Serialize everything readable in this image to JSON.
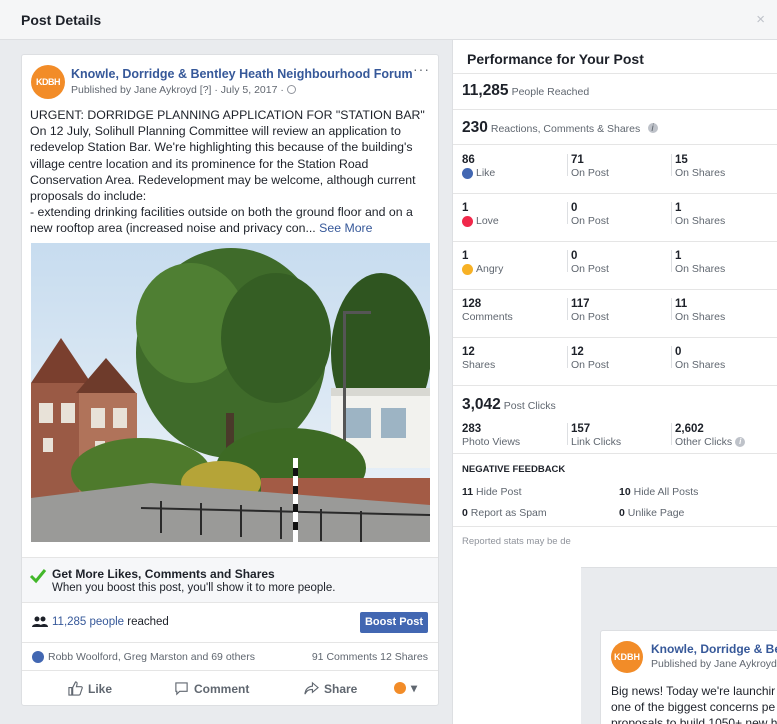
{
  "dialog": {
    "title": "Post Details",
    "close": "×"
  },
  "post": {
    "page_name": "Knowle, Dorridge & Bentley Heath Neighbourhood Forum",
    "avatar_text": "KDBH",
    "published": "Published by Jane Aykroyd [?] · July 5, 2017 · ",
    "more": "···",
    "text_lines": [
      "URGENT: DORRIDGE PLANNING APPLICATION FOR \"STATION BAR\"",
      "On 12 July, Solihull Planning Committee will review an application to redevelop Station Bar. We're highlighting this because of the building's village centre location and its prominence for the Station Road Conservation Area. Redevelopment may be welcome, although current proposals do include:",
      "- extending drinking facilities outside on both the ground floor and on a new rooftop area (increased noise and privacy con..."
    ],
    "see_more": "See More"
  },
  "boost_promo": {
    "title": "Get More Likes, Comments and Shares",
    "subtitle": "When you boost this post, you'll show it to more people."
  },
  "reach": {
    "link": "11,285 people",
    "suffix": " reached",
    "button": "Boost Post"
  },
  "reactions_bar": {
    "reactors": "Robb Woolford, Greg Marston and 69 others",
    "counts": "91 Comments  12 Shares"
  },
  "actions": {
    "like": "Like",
    "comment": "Comment",
    "share": "Share",
    "caret": "▾"
  },
  "performance": {
    "title": "Performance for Your Post",
    "people_reached": {
      "value": "11,285",
      "label": "People Reached"
    },
    "engagement": {
      "value": "230",
      "label": "Reactions, Comments & Shares"
    },
    "info_glyph": "i",
    "rows": [
      {
        "total": "86",
        "total_label": "Like",
        "icon": "like",
        "on_post": "71",
        "on_shares": "15"
      },
      {
        "total": "1",
        "total_label": "Love",
        "icon": "love",
        "on_post": "0",
        "on_shares": "1"
      },
      {
        "total": "1",
        "total_label": "Angry",
        "icon": "angry",
        "on_post": "0",
        "on_shares": "1"
      },
      {
        "total": "128",
        "total_label": "Comments",
        "icon": "",
        "on_post": "117",
        "on_shares": "11"
      },
      {
        "total": "12",
        "total_label": "Shares",
        "icon": "",
        "on_post": "12",
        "on_shares": "0"
      }
    ],
    "on_post_label": "On Post",
    "on_shares_label": "On Shares",
    "post_clicks": {
      "value": "3,042",
      "label": "Post Clicks"
    },
    "clicks": [
      {
        "value": "283",
        "label": "Photo Views"
      },
      {
        "value": "157",
        "label": "Link Clicks"
      },
      {
        "value": "2,602",
        "label": "Other Clicks"
      }
    ],
    "negative": {
      "title": "NEGATIVE FEEDBACK",
      "items": [
        {
          "value": "11",
          "label": "Hide Post"
        },
        {
          "value": "10",
          "label": "Hide All Posts"
        },
        {
          "value": "0",
          "label": "Report as Spam"
        },
        {
          "value": "0",
          "label": "Unlike Page"
        }
      ]
    },
    "footnote": "Reported stats may be de"
  },
  "overlay_post": {
    "page_name": "Knowle, Dorridge & Be",
    "avatar_text": "KDBH",
    "published": "Published by Jane Aykroyd",
    "lines": [
      "Big news! Today we're launchir",
      "one of the biggest concerns pe",
      "proposals to build 1050+ new h"
    ]
  },
  "colors": {
    "link": "#365899",
    "primary_button": "#4267b2",
    "avatar": "#f28c28",
    "love": "#f0284a",
    "angry": "#f7b125",
    "check": "#42b72a"
  }
}
